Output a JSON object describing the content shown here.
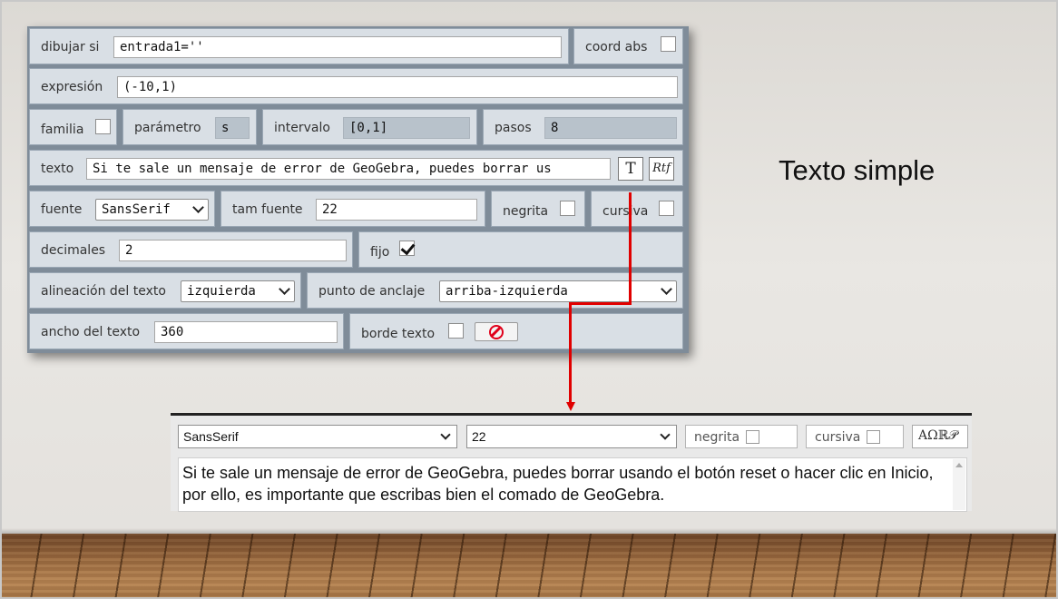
{
  "slide": {
    "title": "Texto simple"
  },
  "panel": {
    "draw_if": {
      "label": "dibujar si",
      "value": "entrada1=''"
    },
    "coord_abs": {
      "label": "coord abs",
      "checked": false
    },
    "expression": {
      "label": "expresión",
      "value": "(-10,1)"
    },
    "family": {
      "label": "familia",
      "checked": false
    },
    "parameter": {
      "label": "parámetro",
      "value": "s"
    },
    "interval": {
      "label": "intervalo",
      "value": "[0,1]"
    },
    "steps": {
      "label": "pasos",
      "value": "8"
    },
    "text": {
      "label": "texto",
      "value": "Si te sale un mensaje de error de GeoGebra, puedes borrar us",
      "btn_text": "T",
      "btn_rich": "Rtf"
    },
    "font": {
      "label": "fuente",
      "value": "SansSerif"
    },
    "font_size": {
      "label": "tam fuente",
      "value": "22"
    },
    "bold": {
      "label": "negrita",
      "checked": false
    },
    "italic": {
      "label": "cursiva",
      "checked": false
    },
    "decimals": {
      "label": "decimales",
      "value": "2"
    },
    "fixed": {
      "label": "fijo",
      "checked": true
    },
    "alignment": {
      "label": "alineación del texto",
      "value": "izquierda"
    },
    "anchor": {
      "label": "punto de anclaje",
      "value": "arriba-izquierda"
    },
    "text_width": {
      "label": "ancho del texto",
      "value": "360"
    },
    "border": {
      "label": "borde texto",
      "checked": false
    }
  },
  "editor": {
    "font_value": "SansSerif",
    "size_value": "22",
    "bold_label": "negrita",
    "italic_label": "cursiva",
    "symbols_label": "AΩℝ𝒫",
    "content": "Si te sale un mensaje de error de GeoGebra, puedes borrar usando el botón reset o hacer clic en Inicio, por ello, es importante que escribas bien el comado de GeoGebra."
  },
  "colors": {
    "arrow": "#e00000",
    "panel_bg": "#7f8c99",
    "cell_bg": "#d9dfe5"
  }
}
